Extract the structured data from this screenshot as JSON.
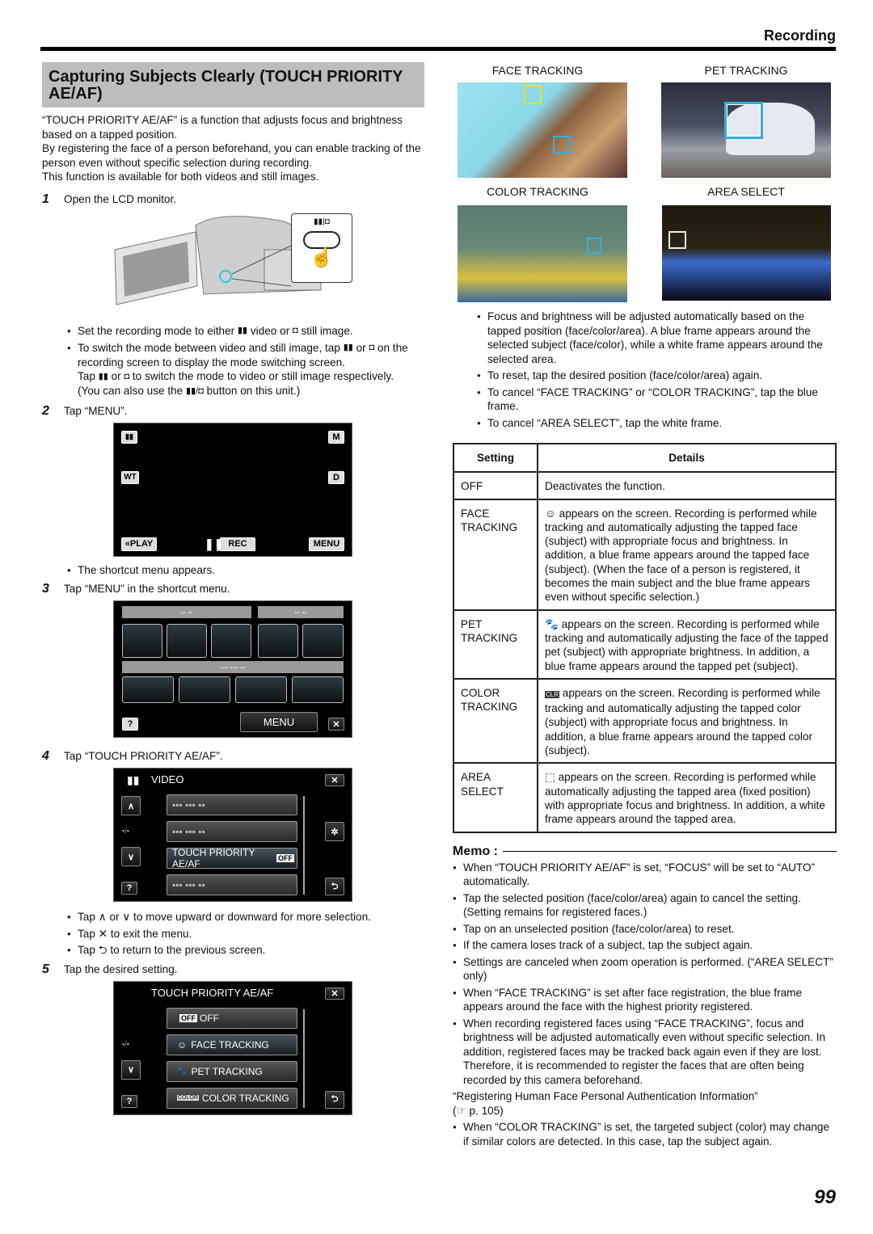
{
  "header": {
    "section": "Recording"
  },
  "title": "Capturing Subjects Clearly (TOUCH PRIORITY AE/AF)",
  "intro": [
    "“TOUCH PRIORITY AE/AF” is a function that adjusts focus and brightness based on a tapped position.",
    "By registering the face of a person beforehand, you can enable tracking of the person even without specific selection during recording.",
    "This function is available for both videos and still images."
  ],
  "steps": [
    {
      "num": "1",
      "text": "Open the LCD monitor."
    },
    {
      "num": "2",
      "text": "Tap “MENU”."
    },
    {
      "num": "3",
      "text": "Tap “MENU” in the shortcut menu."
    },
    {
      "num": "4",
      "text": "Tap “TOUCH PRIORITY AE/AF”."
    },
    {
      "num": "5",
      "text": "Tap the desired setting."
    }
  ],
  "step1_notes": {
    "b1_pre": "Set the recording mode to either",
    "b1_mid": "video or",
    "b1_post": "still image.",
    "b2_a": "To switch the mode between video and still image, tap",
    "b2_b": "or",
    "b2_c": "on the recording screen to display the mode switching screen.",
    "b2_d": "Tap",
    "b2_e": "or",
    "b2_f": "to switch the mode to video or still image respectively.",
    "b2_g": "(You can also use the",
    "b2_h": "button on this unit.)"
  },
  "step2_note": "The shortcut menu appears.",
  "step4_notes": {
    "n1_a": "Tap",
    "n1_b": "or",
    "n1_c": "to move upward or downward for more selection.",
    "n2_a": "Tap",
    "n2_b": "to exit the menu.",
    "n3_a": "Tap",
    "n3_b": "to return to the previous screen."
  },
  "rec_screen": {
    "mode": "M",
    "wt": "WT",
    "d": "D",
    "play": "«PLAY",
    "rec": "REC",
    "menu": "MENU"
  },
  "shortcut_screen": {
    "menu": "MENU",
    "help": "?",
    "close": "✕"
  },
  "video_menu": {
    "title": "VIDEO",
    "selected_item": "TOUCH PRIORITY AE/AF",
    "selected_value": "OFF",
    "page": "▪/▪",
    "help": "?"
  },
  "tp_menu": {
    "title": "TOUCH PRIORITY AE/AF",
    "items": [
      {
        "icon": "OFF",
        "label": "OFF"
      },
      {
        "icon": "☺",
        "label": "FACE TRACKING"
      },
      {
        "icon": "🐾",
        "label": "PET TRACKING"
      },
      {
        "icon": "COLOR",
        "label": "COLOR TRACKING"
      }
    ],
    "page": "▪/▪",
    "help": "?"
  },
  "examples": [
    {
      "caption": "FACE TRACKING"
    },
    {
      "caption": "PET TRACKING"
    },
    {
      "caption": "COLOR TRACKING"
    },
    {
      "caption": "AREA SELECT"
    }
  ],
  "right_bullets": [
    "Focus and brightness will be adjusted automatically based on the tapped position (face/color/area). A blue frame appears around the selected subject (face/color), while a white frame appears around the selected area.",
    "To reset, tap the desired position (face/color/area) again.",
    "To cancel “FACE TRACKING” or “COLOR TRACKING”, tap the blue frame.",
    "To cancel “AREA SELECT”, tap the white frame."
  ],
  "table": {
    "headers": [
      "Setting",
      "Details"
    ],
    "rows": [
      {
        "setting": "OFF",
        "details": "Deactivates the function."
      },
      {
        "setting": "FACE TRACKING",
        "details": " appears on the screen. Recording is performed while tracking and automatically adjusting the tapped face (subject) with appropriate focus and brightness. In addition, a blue frame appears around the tapped face (subject). (When the face of a person is registered, it becomes the main subject and the blue frame appears even without specific selection.)"
      },
      {
        "setting": "PET TRACKING",
        "details": " appears on the screen. Recording is performed while tracking and automatically adjusting the face of the tapped pet (subject) with appropriate brightness. In addition, a blue frame appears around the tapped pet (subject)."
      },
      {
        "setting": "COLOR TRACKING",
        "details": " appears on the screen. Recording is performed while tracking and automatically adjusting the tapped color (subject) with appropriate focus and brightness. In addition, a blue frame appears around the tapped color (subject)."
      },
      {
        "setting": "AREA SELECT",
        "details": " appears on the screen. Recording is performed while automatically adjusting the tapped area (fixed position) with appropriate focus and brightness. In addition, a white frame appears around the tapped area."
      }
    ]
  },
  "memo": {
    "label": "Memo :",
    "items": [
      "When “TOUCH PRIORITY AE/AF” is set, “FOCUS” will be set to “AUTO” automatically.",
      "Tap the selected position (face/color/area) again to cancel the setting. (Setting remains for registered faces.)",
      "Tap on an unselected position (face/color/area) to reset.",
      "If the camera loses track of a subject, tap the subject again.",
      "Settings are canceled when zoom operation is performed. (“AREA SELECT” only)",
      "When “FACE TRACKING” is set after face registration, the blue frame appears around the face with the highest priority registered.",
      "When recording registered faces using “FACE TRACKING”, focus and brightness will be adjusted automatically even without specific selection. In addition, registered faces may be tracked back again even if they are lost. Therefore, it is recommended to register the faces that are often being recorded by this camera beforehand."
    ],
    "link_text": "“Registering Human Face Personal Authentication Information”",
    "link_ref": "(☞ p. 105)",
    "last_item": "When “COLOR TRACKING” is set, the targeted subject (color) may change if similar colors are detected. In this case, tap the subject again."
  },
  "page_number": "99"
}
